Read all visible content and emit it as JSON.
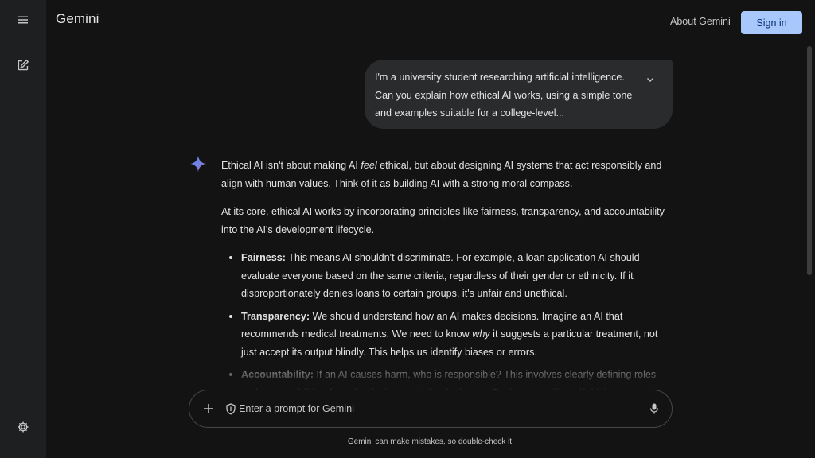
{
  "header": {
    "brand": "Gemini",
    "about_label": "About Gemini",
    "signin_label": "Sign in"
  },
  "rail": {
    "icons": [
      "menu-icon",
      "edit-icon",
      "gear-icon"
    ]
  },
  "user_message": {
    "text": "I'm a university student researching artificial intelligence. Can you explain how ethical AI works, using a simple tone and examples suitable for a college-level..."
  },
  "response": {
    "p1_before": "Ethical AI isn't about making AI ",
    "p1_em": "feel",
    "p1_after": " ethical, but about designing AI systems that act responsibly and align with human values. Think of it as building AI with a strong moral compass.",
    "p2": "At its core, ethical AI works by incorporating principles like fairness, transparency, and accountability into the AI's development lifecycle.",
    "bullets": [
      {
        "term": "Fairness:",
        "text": " This means AI shouldn't discriminate. For example, a loan application AI should evaluate everyone based on the same criteria, regardless of their gender or ethnicity. If it disproportionately denies loans to certain groups, it's unfair and unethical."
      },
      {
        "term": "Transparency:",
        "text_before": " We should understand how an AI makes decisions. Imagine an AI that recommends medical treatments. We need to know ",
        "text_em": "why",
        "text_after": " it suggests a particular treatment, not just accept its output blindly. This helps us identify biases or errors."
      },
      {
        "term": "Accountability:",
        "text": " If an AI causes harm, who is responsible? This involves clearly defining roles and responsibilities from the designers to the deployers. For instance, if a self-driving car"
      }
    ]
  },
  "prompt": {
    "placeholder": "Enter a prompt for Gemini"
  },
  "disclaimer": "Gemini can make mistakes, so double-check it",
  "colors": {
    "background": "#131314",
    "rail": "#1e1f20",
    "bubble": "#2a2b2d",
    "accent": "#a8c7fa",
    "accent_text": "#062e6f"
  }
}
